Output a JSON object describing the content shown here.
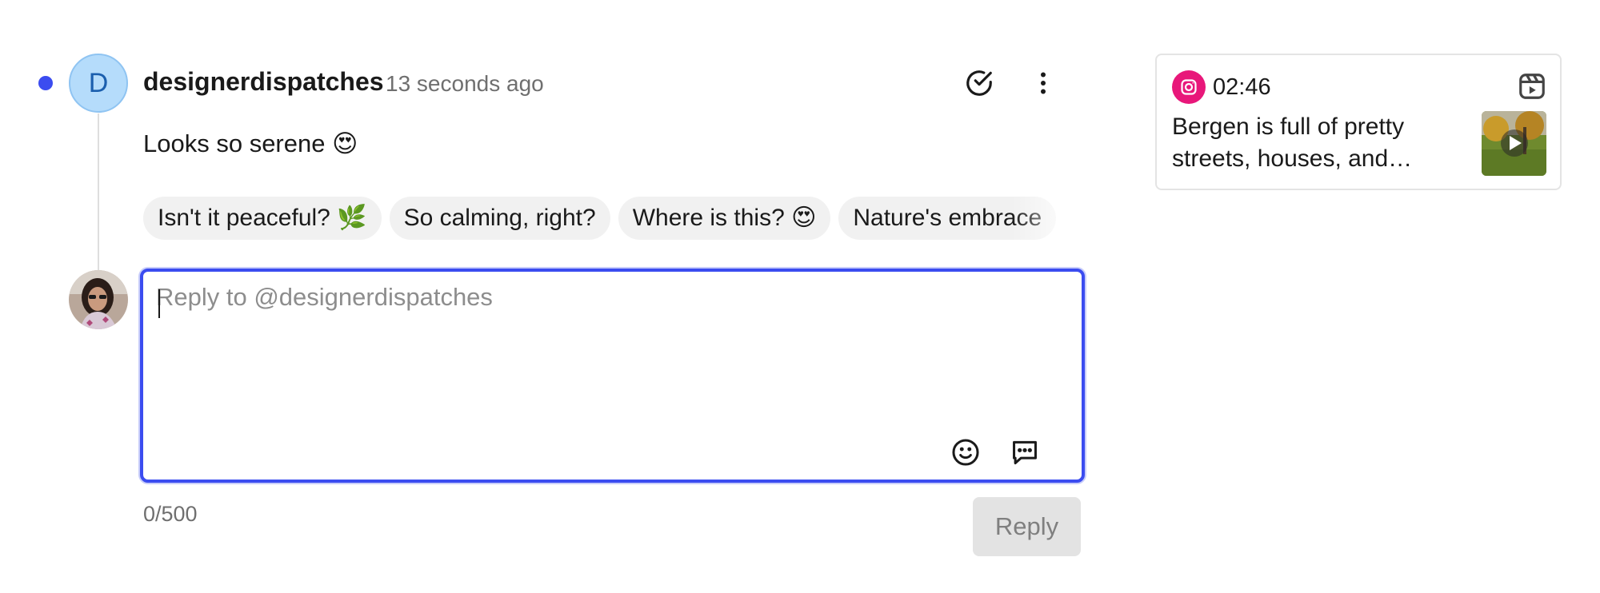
{
  "comment": {
    "avatar_letter": "D",
    "author": "designerdispatches",
    "timestamp": "13 seconds ago",
    "text": "Looks so serene 😍"
  },
  "suggestions": [
    "Isn't it peaceful? 🌿",
    "So calming, right?",
    "Where is this? 😍",
    "Nature's embrace"
  ],
  "reply": {
    "placeholder": "Reply to @designerdispatches",
    "value": "",
    "counter": "0/500",
    "button_label": "Reply"
  },
  "post_card": {
    "platform_icon": "instagram-icon",
    "duration": "02:46",
    "caption": "Bergen is full of pretty streets, houses, and everything else",
    "type_icon": "reels-icon"
  },
  "colors": {
    "accent": "#3b4cf0",
    "unread": "#3b4cf0",
    "avatar_bg": "#b5dcfb",
    "instagram": "#e8177a",
    "chip_bg": "#f1f1f1",
    "disabled_button": "#e3e3e3"
  }
}
